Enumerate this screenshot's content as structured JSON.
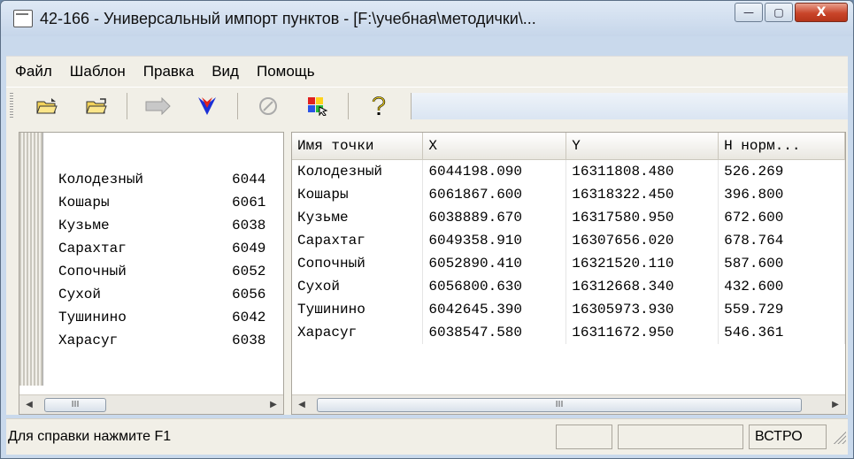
{
  "window": {
    "title": "42-166 - Универсальный импорт пунктов - [F:\\учебная\\методички\\...",
    "controls": {
      "minimize": "—",
      "maximize": "▢",
      "close": "X"
    }
  },
  "menu": [
    "Файл",
    "Шаблон",
    "Правка",
    "Вид",
    "Помощь"
  ],
  "toolbar": {
    "icons": [
      "open-folder-icon",
      "open-folder-2-icon",
      "play-arrow-icon",
      "red-blue-v-icon",
      "disabled-circle-icon",
      "color-grid-icon",
      "help-question-icon"
    ]
  },
  "left_pane": {
    "rows": [
      {
        "name": "Колодезный",
        "num": "6044"
      },
      {
        "name": "Кошары",
        "num": "6061"
      },
      {
        "name": "Кузьме",
        "num": "6038"
      },
      {
        "name": "Сарахтаг",
        "num": "6049"
      },
      {
        "name": "Сопочный",
        "num": "6052"
      },
      {
        "name": "Сухой",
        "num": "6056"
      },
      {
        "name": "Тушинино",
        "num": "6042"
      },
      {
        "name": "Харасуг",
        "num": "6038"
      }
    ],
    "scroll_thumb": "III"
  },
  "table": {
    "columns": [
      "Имя точки",
      "X",
      "Y",
      "H норм..."
    ],
    "rows": [
      [
        "Колодезный",
        "6044198.090",
        "16311808.480",
        "526.269"
      ],
      [
        "Кошары",
        "6061867.600",
        "16318322.450",
        "396.800"
      ],
      [
        "Кузьме",
        "6038889.670",
        "16317580.950",
        "672.600"
      ],
      [
        "Сарахтаг",
        "6049358.910",
        "16307656.020",
        "678.764"
      ],
      [
        "Сопочный",
        "6052890.410",
        "16321520.110",
        "587.600"
      ],
      [
        "Сухой",
        "6056800.630",
        "16312668.340",
        "432.600"
      ],
      [
        "Тушинино",
        "6042645.390",
        "16305973.930",
        "559.729"
      ],
      [
        "Харасуг",
        "6038547.580",
        "16311672.950",
        "546.361"
      ]
    ],
    "scroll_thumb": "III"
  },
  "status": {
    "text": "Для справки нажмите F1",
    "panel3": "ВСТРО"
  }
}
